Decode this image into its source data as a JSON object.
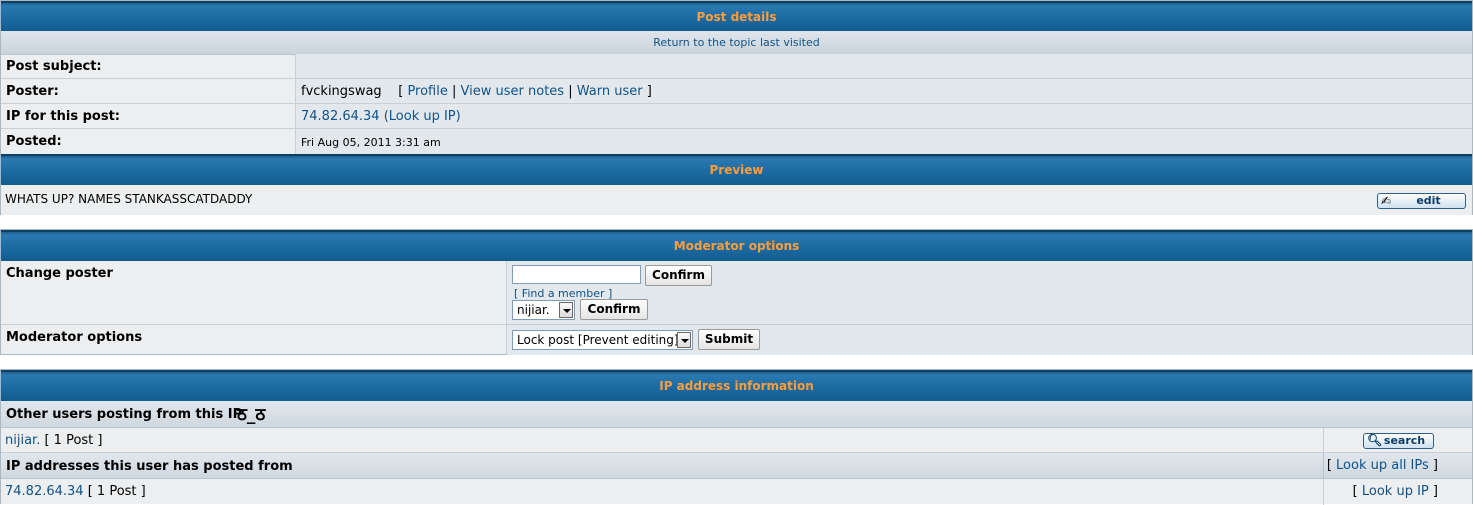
{
  "post_details": {
    "header": "Post details",
    "return_link": "Return to the topic last visited",
    "subject_label": "Post subject:",
    "subject_value": "",
    "poster_label": "Poster:",
    "poster_name": "fvckingswag",
    "bracket_open": "[",
    "bracket_close": "]",
    "separator": "|",
    "profile_link": "Profile",
    "user_notes_link": "View user notes",
    "warn_user_link": "Warn user",
    "ip_label": "IP for this post:",
    "ip_value": "74.82.64.34 (Look up IP)",
    "posted_label": "Posted:",
    "posted_value": "Fri Aug 05, 2011 3:31 am"
  },
  "preview": {
    "header": "Preview",
    "text": "WHATS UP? NAMES STANKASSCATDADDY",
    "edit_button": "edit"
  },
  "moderator": {
    "header": "Moderator options",
    "change_poster_label": "Change poster",
    "username_value": "",
    "confirm_label": "Confirm",
    "find_member_link": "[ Find a member ]",
    "member_select_value": "nijiar.",
    "options_label": "Moderator options",
    "options_select_value": "Lock post [Prevent editing]",
    "submit_label": "Submit"
  },
  "ip_info": {
    "header": "IP address information",
    "other_users_label": "Other users posting from this IP",
    "emoticon": "ठ_ठ",
    "other_user_name": "nijiar.",
    "other_user_posts": "[ 1 Post ]",
    "search_button": "search",
    "ips_label": "IP addresses this user has posted from",
    "look_up_all_ips": "Look up all IPs",
    "ip_row_value": "74.82.64.34",
    "ip_row_posts": "[ 1 Post ]",
    "look_up_ip": "Look up IP"
  }
}
